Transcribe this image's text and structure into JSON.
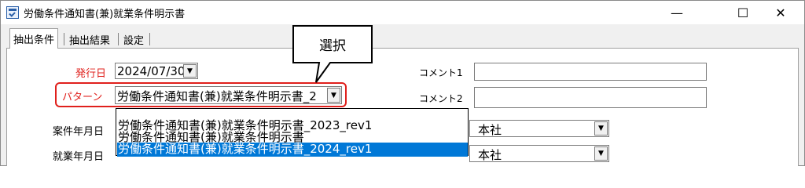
{
  "window": {
    "title": "労働条件通知書(兼)就業条件明示書",
    "minimize_glyph": "—",
    "maximize_glyph": "☐",
    "close_glyph": "✕"
  },
  "tabs": [
    {
      "label": "抽出条件",
      "active": true
    },
    {
      "label": "抽出結果",
      "active": false
    },
    {
      "label": "設定",
      "active": false
    }
  ],
  "form": {
    "issue_date_label": "発行日",
    "issue_date_value": "2024/07/30",
    "pattern_label": "パターン",
    "pattern_value": "労働条件通知書(兼)就業条件明示書_2",
    "case_ym_label": "案件年月日",
    "work_ym_label": "就業年月日",
    "comment1_label": "コメント1",
    "comment2_label": "コメント2",
    "office1_value": "本社",
    "office2_value": "本社"
  },
  "dropdown": {
    "options": [
      "労働条件通知書(兼)就業条件明示書_2023_rev1",
      "労働条件通知書(兼)就業条件明示書",
      "労働条件通知書(兼)就業条件明示書_2024_rev1"
    ],
    "selected_index": 2
  },
  "callout": {
    "text": "選択"
  },
  "colors": {
    "accent": "#e0201c",
    "selection": "#0078d7"
  }
}
